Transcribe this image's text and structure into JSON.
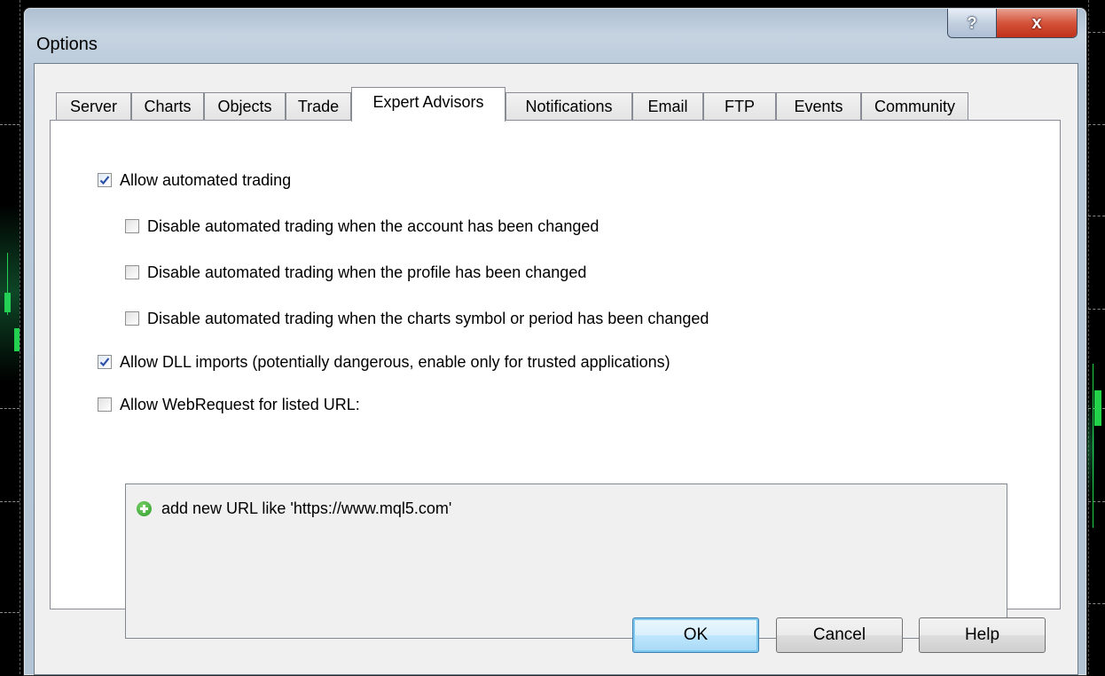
{
  "window": {
    "title": "Options",
    "help_glyph": "?",
    "close_glyph": "x"
  },
  "tabs": [
    {
      "label": "Server",
      "active": false
    },
    {
      "label": "Charts",
      "active": false
    },
    {
      "label": "Objects",
      "active": false
    },
    {
      "label": "Trade",
      "active": false
    },
    {
      "label": "Expert Advisors",
      "active": true
    },
    {
      "label": "Notifications",
      "active": false
    },
    {
      "label": "Email",
      "active": false
    },
    {
      "label": "FTP",
      "active": false
    },
    {
      "label": "Events",
      "active": false
    },
    {
      "label": "Community",
      "active": false
    }
  ],
  "options": [
    {
      "label": "Allow automated trading",
      "checked": true
    },
    {
      "label": "Disable automated trading when the account has been changed",
      "checked": false
    },
    {
      "label": "Disable automated trading when the profile has been changed",
      "checked": false
    },
    {
      "label": "Disable automated trading when the charts symbol or period has been changed",
      "checked": false
    },
    {
      "label": "Allow DLL imports (potentially dangerous, enable only for trusted applications)",
      "checked": true
    },
    {
      "label": "Allow WebRequest for listed URL:",
      "checked": false
    }
  ],
  "url_list": {
    "add_text": "add new URL like 'https://www.mql5.com'",
    "icon": "add-circle-icon"
  },
  "buttons": {
    "ok": "OK",
    "cancel": "Cancel",
    "help": "Help"
  },
  "colors": {
    "candle": "#22d34a",
    "default_button_border": "#3c7fb1",
    "close_button": "#c0301a"
  }
}
